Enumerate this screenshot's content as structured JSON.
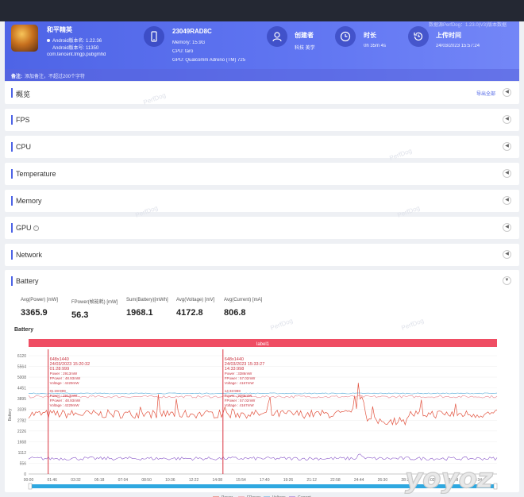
{
  "header": {
    "version_note": "数据源PerfDog：1.23.0(V3)版本数据",
    "app_name": "和平精英",
    "android_version_name": "Android版本名: 1.22.36",
    "android_version_code": "Android版本号: 11350",
    "package": "com.tencent.tmgp.pubgmhd",
    "device": "23049RAD8C",
    "memory": "Memory: 15.9G",
    "cpu": "CPU: taro",
    "gpu": "GPU: Qualcomm Adreno (TM) 725",
    "creator_label": "创建者",
    "creator_value": "科技 美学",
    "duration_label": "时长",
    "duration_value": "0h 35m 4s",
    "upload_label": "上传时间",
    "upload_value": "24/03/2023 15:57:24",
    "note_label": "备注:",
    "note_text": "添加备注，不超过200个字符"
  },
  "sections": [
    {
      "label": "概览",
      "action": "导出全部"
    },
    {
      "label": "FPS"
    },
    {
      "label": "CPU"
    },
    {
      "label": "Temperature"
    },
    {
      "label": "Memory"
    },
    {
      "label": "GPU"
    },
    {
      "label": "Network"
    },
    {
      "label": "Battery"
    }
  ],
  "battery": {
    "stats": [
      {
        "label": "Avg(Power) [mW]",
        "value": "3365.9"
      },
      {
        "label": "FPower(帧能耗) [mW]",
        "value": "56.3"
      },
      {
        "label": "Sum(Battery)[mWh]",
        "value": "1968.1"
      },
      {
        "label": "Avg(Voltage) [mV]",
        "value": "4172.8"
      },
      {
        "label": "Avg(Current) [mA]",
        "value": "806.8"
      }
    ],
    "chart_title": "Battery",
    "watermark": "PerfDog"
  },
  "colors": {
    "accent": "#4c63e6",
    "label_bar": "#ef4d63",
    "power": "#e2533f",
    "fpower": "#e7858f",
    "voltage": "#4aa5d6",
    "current": "#8a58c9",
    "slider": "#2fa8e0"
  },
  "chart_data": {
    "type": "line",
    "label_band": "label1",
    "ylabel": "Battery",
    "y_ticks": [
      0,
      556,
      1112,
      1668,
      2226,
      2782,
      3339,
      3895,
      4451,
      5008,
      5564,
      6120
    ],
    "ylim": [
      0,
      6120
    ],
    "x_ticks": [
      "00:00",
      "01:46",
      "03:32",
      "05:18",
      "07:04",
      "08:50",
      "10:36",
      "12:22",
      "14:08",
      "15:54",
      "17:40",
      "19:26",
      "21:12",
      "22:58",
      "24:44",
      "26:30",
      "28:16",
      "30:02",
      "31:48",
      "33:34"
    ],
    "xlim_seconds": [
      0,
      2104
    ],
    "series": [
      {
        "name": "Power",
        "color": "#e2533f",
        "baseline": 3100,
        "noise": 220
      },
      {
        "name": "FPower",
        "color": "#e7858f",
        "baseline": 4000,
        "noise": 60
      },
      {
        "name": "Voltage",
        "color": "#4aa5d6",
        "baseline": 4170,
        "noise": 25
      },
      {
        "name": "Current",
        "color": "#8a58c9",
        "baseline": 800,
        "noise": 90
      }
    ],
    "markers": [
      {
        "at": "01:28",
        "resolution": "648x1440",
        "datetime": "24/03/2023 15:20:32",
        "time": "01:28:999",
        "power": "Power : 2913mW",
        "fpower": "FPower : 48.93mW",
        "voltage": "Voltage : 4229mW"
      },
      {
        "at": "14:33",
        "resolution": "648x1440",
        "datetime": "24/03/2023 15:33:27",
        "time": "14:33:998",
        "power": "Power : 3386mW",
        "fpower": "FPower : 57.02mW",
        "voltage": "Voltage : 4167mW"
      }
    ]
  }
}
